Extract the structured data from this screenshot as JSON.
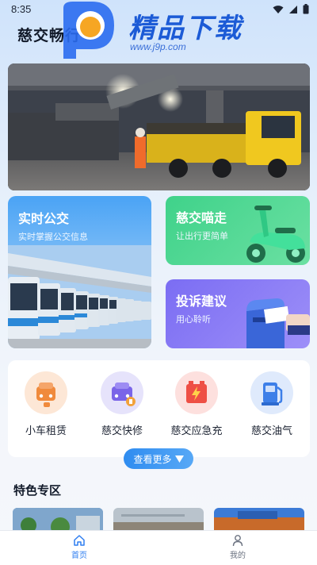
{
  "status_bar": {
    "time": "8:35"
  },
  "header": {
    "title": "慈交畅行"
  },
  "watermark": {
    "brand": "精品下载",
    "url": "www.j9p.com"
  },
  "cards": {
    "bus": {
      "title": "实时公交",
      "subtitle": "实时掌握公交信息"
    },
    "miaozou": {
      "title": "慈交喵走",
      "subtitle": "让出行更简单"
    },
    "complaint": {
      "title": "投诉建议",
      "subtitle": "用心聆听"
    }
  },
  "services": [
    {
      "label": "小车租赁",
      "icon": "car-rental-icon",
      "bg": "#fde7d6",
      "fg": "#f08a3c"
    },
    {
      "label": "慈交快修",
      "icon": "car-repair-icon",
      "bg": "#e6e3fb",
      "fg": "#7a64e8"
    },
    {
      "label": "慈交应急充",
      "icon": "emergency-charge-icon",
      "bg": "#fde0de",
      "fg": "#ee4f45"
    },
    {
      "label": "慈交油气",
      "icon": "gas-station-icon",
      "bg": "#dfeafc",
      "fg": "#3d7fe8"
    }
  ],
  "more_button": {
    "label": "查看更多"
  },
  "special_section": {
    "title": "特色专区"
  },
  "bottom_nav": {
    "home": {
      "label": "首页",
      "color": "#2f7ef0"
    },
    "mine": {
      "label": "我的",
      "color": "#6b7280"
    }
  },
  "colors": {
    "accent": "#2f8cf0",
    "brand_blue": "#1c5bd6"
  }
}
